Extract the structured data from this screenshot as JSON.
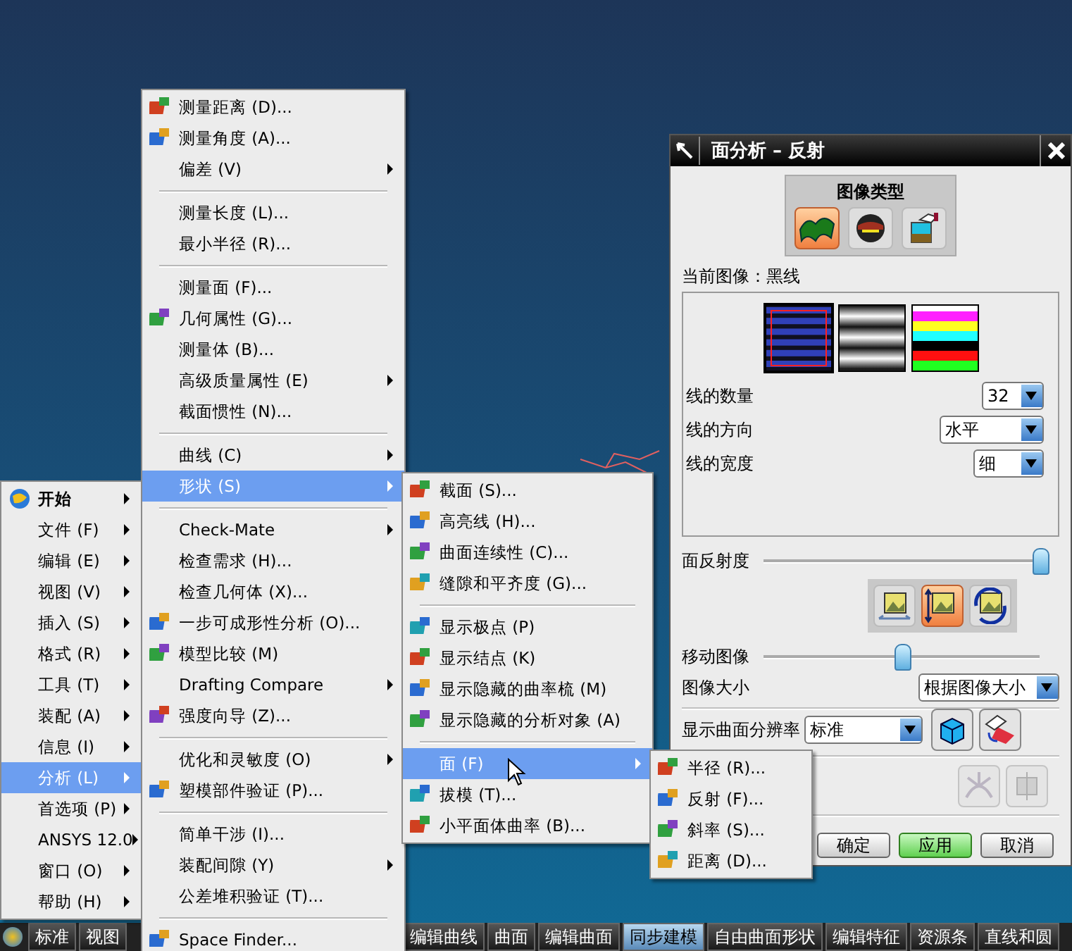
{
  "main_menu": [
    {
      "label": "开始",
      "bold": true,
      "icon": true,
      "selected": false
    },
    {
      "label": "文件 (F)",
      "bold": false,
      "icon": false,
      "selected": false
    },
    {
      "label": "编辑 (E)",
      "bold": false,
      "icon": false,
      "selected": false
    },
    {
      "label": "视图 (V)",
      "bold": false,
      "icon": false,
      "selected": false
    },
    {
      "label": "插入 (S)",
      "bold": false,
      "icon": false,
      "selected": false
    },
    {
      "label": "格式 (R)",
      "bold": false,
      "icon": false,
      "selected": false
    },
    {
      "label": "工具 (T)",
      "bold": false,
      "icon": false,
      "selected": false
    },
    {
      "label": "装配 (A)",
      "bold": false,
      "icon": false,
      "selected": false
    },
    {
      "label": "信息 (I)",
      "bold": false,
      "icon": false,
      "selected": false
    },
    {
      "label": "分析 (L)",
      "bold": false,
      "icon": false,
      "selected": true
    },
    {
      "label": "首选项 (P)",
      "bold": false,
      "icon": false,
      "selected": false
    },
    {
      "label": "ANSYS 12.0",
      "bold": false,
      "icon": false,
      "selected": false
    },
    {
      "label": "窗口 (O)",
      "bold": false,
      "icon": false,
      "selected": false
    },
    {
      "label": "帮助 (H)",
      "bold": false,
      "icon": false,
      "selected": false
    }
  ],
  "analysis_menu": [
    {
      "kind": "item",
      "label": "测量距离 (D)...",
      "icon": true,
      "submenu": false,
      "selected": false
    },
    {
      "kind": "item",
      "label": "测量角度 (A)...",
      "icon": true,
      "submenu": false,
      "selected": false
    },
    {
      "kind": "item",
      "label": "偏差 (V)",
      "icon": false,
      "submenu": true,
      "selected": false
    },
    {
      "kind": "separator"
    },
    {
      "kind": "item",
      "label": "测量长度 (L)...",
      "icon": false,
      "submenu": false,
      "selected": false
    },
    {
      "kind": "item",
      "label": "最小半径 (R)...",
      "icon": false,
      "submenu": false,
      "selected": false
    },
    {
      "kind": "separator"
    },
    {
      "kind": "item",
      "label": "测量面 (F)...",
      "icon": false,
      "submenu": false,
      "selected": false
    },
    {
      "kind": "item",
      "label": "几何属性 (G)...",
      "icon": true,
      "submenu": false,
      "selected": false
    },
    {
      "kind": "item",
      "label": "测量体 (B)...",
      "icon": false,
      "submenu": false,
      "selected": false
    },
    {
      "kind": "item",
      "label": "高级质量属性 (E)",
      "icon": false,
      "submenu": true,
      "selected": false
    },
    {
      "kind": "item",
      "label": "截面惯性 (N)...",
      "icon": false,
      "submenu": false,
      "selected": false
    },
    {
      "kind": "separator"
    },
    {
      "kind": "item",
      "label": "曲线 (C)",
      "icon": false,
      "submenu": true,
      "selected": false
    },
    {
      "kind": "item",
      "label": "形状 (S)",
      "icon": false,
      "submenu": true,
      "selected": true
    },
    {
      "kind": "separator"
    },
    {
      "kind": "item",
      "label": "Check-Mate",
      "icon": false,
      "submenu": true,
      "selected": false
    },
    {
      "kind": "item",
      "label": "检查需求 (H)...",
      "icon": false,
      "submenu": false,
      "selected": false
    },
    {
      "kind": "item",
      "label": "检查几何体 (X)...",
      "icon": false,
      "submenu": false,
      "selected": false
    },
    {
      "kind": "item",
      "label": "一步可成形性分析 (O)...",
      "icon": true,
      "submenu": false,
      "selected": false
    },
    {
      "kind": "item",
      "label": "模型比较 (M)",
      "icon": true,
      "submenu": false,
      "selected": false
    },
    {
      "kind": "item",
      "label": "Drafting Compare",
      "icon": false,
      "submenu": true,
      "selected": false
    },
    {
      "kind": "item",
      "label": "强度向导 (Z)...",
      "icon": true,
      "submenu": false,
      "selected": false
    },
    {
      "kind": "separator"
    },
    {
      "kind": "item",
      "label": "优化和灵敏度 (O)",
      "icon": false,
      "submenu": true,
      "selected": false
    },
    {
      "kind": "item",
      "label": "塑模部件验证 (P)...",
      "icon": true,
      "submenu": false,
      "selected": false
    },
    {
      "kind": "separator"
    },
    {
      "kind": "item",
      "label": "简单干涉 (I)...",
      "icon": false,
      "submenu": false,
      "selected": false
    },
    {
      "kind": "item",
      "label": "装配间隙 (Y)",
      "icon": false,
      "submenu": true,
      "selected": false
    },
    {
      "kind": "item",
      "label": "公差堆积验证 (T)...",
      "icon": false,
      "submenu": false,
      "selected": false
    },
    {
      "kind": "separator"
    },
    {
      "kind": "item",
      "label": "Space Finder...",
      "icon": true,
      "submenu": false,
      "selected": false
    }
  ],
  "shape_menu": [
    {
      "kind": "item",
      "label": "截面 (S)...",
      "icon": true,
      "submenu": false,
      "selected": false
    },
    {
      "kind": "item",
      "label": "高亮线 (H)...",
      "icon": true,
      "submenu": false,
      "selected": false
    },
    {
      "kind": "item",
      "label": "曲面连续性 (C)...",
      "icon": true,
      "submenu": false,
      "selected": false
    },
    {
      "kind": "item",
      "label": "缝隙和平齐度 (G)...",
      "icon": true,
      "submenu": false,
      "selected": false
    },
    {
      "kind": "separator"
    },
    {
      "kind": "item",
      "label": "显示极点 (P)",
      "icon": true,
      "submenu": false,
      "selected": false
    },
    {
      "kind": "item",
      "label": "显示结点 (K)",
      "icon": true,
      "submenu": false,
      "selected": false
    },
    {
      "kind": "item",
      "label": "显示隐藏的曲率梳 (M)",
      "icon": true,
      "submenu": false,
      "selected": false
    },
    {
      "kind": "item",
      "label": "显示隐藏的分析对象 (A)",
      "icon": true,
      "submenu": false,
      "selected": false
    },
    {
      "kind": "separator"
    },
    {
      "kind": "item",
      "label": "面 (F)",
      "icon": false,
      "submenu": true,
      "selected": true
    },
    {
      "kind": "item",
      "label": "拔模 (T)...",
      "icon": true,
      "submenu": false,
      "selected": false
    },
    {
      "kind": "item",
      "label": "小平面体曲率 (B)...",
      "icon": true,
      "submenu": false,
      "selected": false
    }
  ],
  "face_menu": [
    {
      "kind": "item",
      "label": "半径 (R)...",
      "icon": true,
      "submenu": false,
      "selected": false
    },
    {
      "kind": "item",
      "label": "反射 (F)...",
      "icon": true,
      "submenu": false,
      "selected": false
    },
    {
      "kind": "item",
      "label": "斜率 (S)...",
      "icon": true,
      "submenu": false,
      "selected": false
    },
    {
      "kind": "item",
      "label": "距离 (D)...",
      "icon": true,
      "submenu": false,
      "selected": false
    }
  ],
  "dialog": {
    "title": "面分析 – 反射",
    "image_type": {
      "label": "图像类型",
      "options": [
        {
          "selected": true
        },
        {
          "selected": false
        },
        {
          "selected": false
        }
      ]
    },
    "current_image": "当前图像：黑线",
    "swatches": [
      {
        "kind": "lines",
        "selected": true
      },
      {
        "kind": "gradient",
        "selected": false
      },
      {
        "kind": "colors",
        "selected": false
      }
    ],
    "fields": [
      {
        "label": "线的数量",
        "value": "32"
      },
      {
        "label": "线的方向",
        "value": "水平"
      },
      {
        "label": "线的宽度",
        "value": "细"
      }
    ],
    "reflectivity": {
      "label": "面反射度",
      "level": 1.0
    },
    "image_tools": [
      {
        "selected": false
      },
      {
        "selected": true
      },
      {
        "selected": false
      }
    ],
    "move_image": {
      "label": "移动图像",
      "level": 0.5
    },
    "image_size": {
      "label": "图像大小",
      "value": "根据图像大小"
    },
    "resolution": {
      "label": "显示曲面分辨率",
      "value": "标准"
    },
    "buttons": [
      {
        "label": "确定",
        "default": false
      },
      {
        "label": "应用",
        "default": true
      },
      {
        "label": "取消",
        "default": false
      }
    ]
  },
  "taskbar": {
    "left": [
      "标准",
      "视图"
    ],
    "right": [
      {
        "label": "编辑曲线",
        "selected": false
      },
      {
        "label": "曲面",
        "selected": false
      },
      {
        "label": "编辑曲面",
        "selected": false
      },
      {
        "label": "同步建模",
        "selected": true
      },
      {
        "label": "自由曲面形状",
        "selected": false
      },
      {
        "label": "编辑特征",
        "selected": false
      },
      {
        "label": "资源条",
        "selected": false
      },
      {
        "label": "直线和圆",
        "selected": false
      }
    ]
  }
}
